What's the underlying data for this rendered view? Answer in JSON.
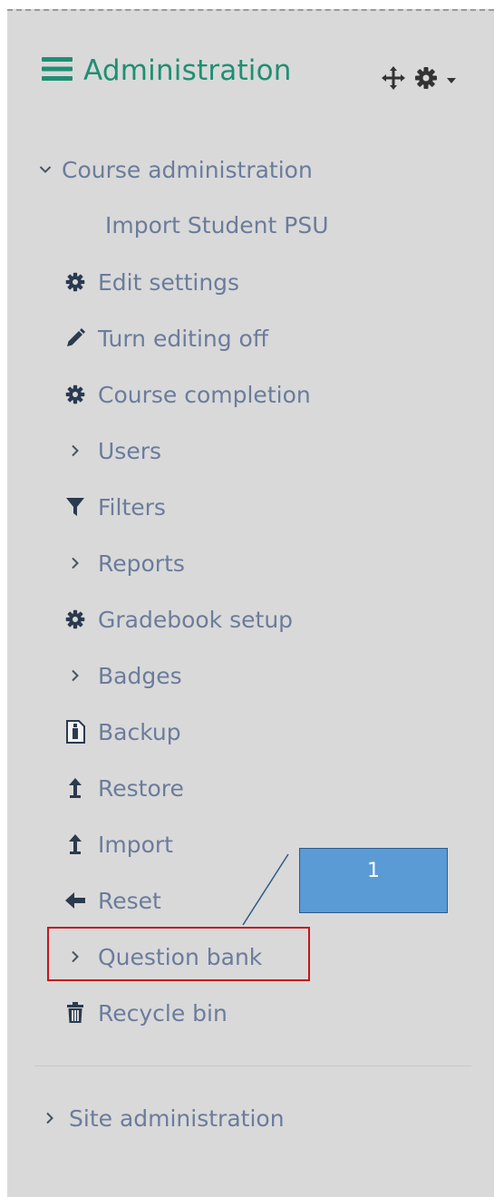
{
  "header": {
    "title": "Administration"
  },
  "course_admin": {
    "label": "Course administration"
  },
  "items": [
    {
      "label": "Import Student PSU"
    },
    {
      "label": "Edit settings"
    },
    {
      "label": "Turn editing off"
    },
    {
      "label": "Course completion"
    },
    {
      "label": "Users"
    },
    {
      "label": "Filters"
    },
    {
      "label": "Reports"
    },
    {
      "label": "Gradebook setup"
    },
    {
      "label": "Badges"
    },
    {
      "label": "Backup"
    },
    {
      "label": "Restore"
    },
    {
      "label": "Import"
    },
    {
      "label": "Reset"
    },
    {
      "label": "Question bank"
    },
    {
      "label": "Recycle bin"
    }
  ],
  "site_admin": {
    "label": "Site administration"
  },
  "callout": {
    "text": "1"
  },
  "colors": {
    "accent": "#1f8f72",
    "link": "#6b7c9c",
    "highlight": "#c4161c",
    "callout": "#5b9bd5"
  }
}
